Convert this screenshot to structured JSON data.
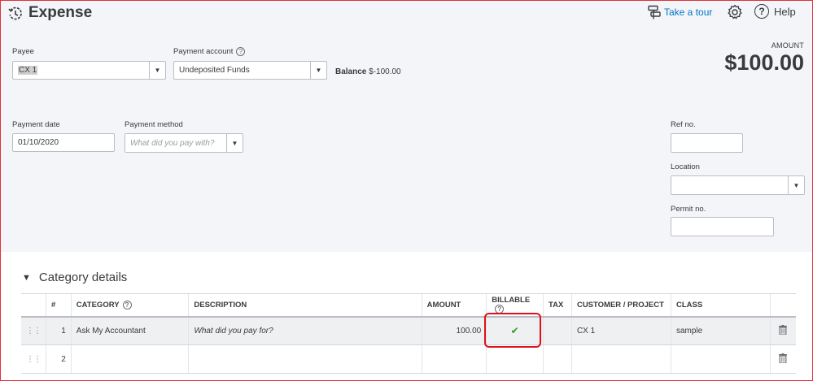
{
  "header": {
    "title": "Expense",
    "take_a_tour": "Take a tour",
    "help": "Help"
  },
  "payee": {
    "label": "Payee",
    "value": "CX 1"
  },
  "payment_account": {
    "label": "Payment account",
    "value": "Undeposited Funds",
    "help_glyph": "?"
  },
  "balance": {
    "label": "Balance",
    "value": "$-100.00"
  },
  "amount": {
    "label": "AMOUNT",
    "value": "$100.00"
  },
  "payment_date": {
    "label": "Payment date",
    "value": "01/10/2020"
  },
  "payment_method": {
    "label": "Payment method",
    "placeholder": "What did you pay with?"
  },
  "ref_no": {
    "label": "Ref no.",
    "value": ""
  },
  "location": {
    "label": "Location",
    "value": ""
  },
  "permit_no": {
    "label": "Permit no.",
    "value": ""
  },
  "category_details": {
    "title": "Category details",
    "columns": {
      "num": "#",
      "category": "CATEGORY",
      "description": "DESCRIPTION",
      "amount": "AMOUNT",
      "billable": "BILLABLE",
      "tax": "TAX",
      "customer": "CUSTOMER / PROJECT",
      "class": "CLASS"
    },
    "rows": [
      {
        "num": "1",
        "category": "Ask My Accountant",
        "description_placeholder": "What did you pay for?",
        "amount": "100.00",
        "billable": true,
        "tax": "",
        "customer": "CX 1",
        "class": "sample"
      },
      {
        "num": "2",
        "category": "",
        "description_placeholder": "",
        "amount": "",
        "billable": false,
        "tax": "",
        "customer": "",
        "class": ""
      }
    ]
  },
  "colors": {
    "accent_link": "#0077c5",
    "form_background": "#f4f5f8",
    "highlight_border": "#e0101a",
    "check_green": "#2ca01c"
  },
  "icons": {
    "history": "history-clock-icon",
    "tour": "tour-signpost-icon",
    "settings": "gear-icon",
    "help": "question-circle-icon",
    "collapse": "triangle-down-icon",
    "drag": "drag-handle-icon",
    "delete": "trash-icon",
    "check": "checkmark-icon"
  }
}
